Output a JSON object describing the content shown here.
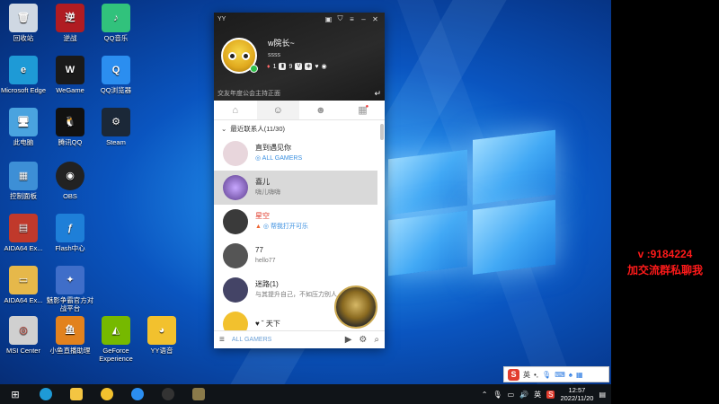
{
  "desktop_icons": [
    {
      "label": "回收站",
      "icon": "recycle-bin-icon",
      "color": "#cfd8e3"
    },
    {
      "label": "逆战",
      "icon": "nizhan-icon",
      "color": "#b01c22"
    },
    {
      "label": "QQ音乐",
      "icon": "qq-music-icon",
      "color": "#31c27c"
    },
    {
      "label": "Microsoft Edge",
      "icon": "edge-icon",
      "color": "#1e9ad6"
    },
    {
      "label": "WeGame",
      "icon": "wegame-icon",
      "color": "#1a1a1a"
    },
    {
      "label": "QQ浏览器",
      "icon": "qq-browser-icon",
      "color": "#2b8ef0"
    },
    {
      "label": "此电脑",
      "icon": "this-pc-icon",
      "color": "#4aa3df"
    },
    {
      "label": "腾讯QQ",
      "icon": "qq-icon",
      "color": "#111111"
    },
    {
      "label": "Steam",
      "icon": "steam-icon",
      "color": "#1b2838"
    },
    {
      "label": "控制面板",
      "icon": "control-panel-icon",
      "color": "#3d8fd6"
    },
    {
      "label": "OBS",
      "icon": "obs-icon",
      "color": "#222222"
    },
    {
      "label": "AIDA64 Ex...",
      "icon": "aida64-icon",
      "color": "#c0392b"
    },
    {
      "label": "Flash中心",
      "icon": "flash-center-icon",
      "color": "#1e7fd8"
    },
    {
      "label": "AIDA64 Ex...",
      "icon": "aida64-folder-icon",
      "color": "#e6b84a"
    },
    {
      "label": "魅影争霸官方对战平台",
      "icon": "game-platform-icon",
      "color": "#3f6ec9"
    },
    {
      "label": "MSI Center",
      "icon": "msi-center-icon",
      "color": "#d0d0d0"
    },
    {
      "label": "小鱼直播助理",
      "icon": "xiaoyu-icon",
      "color": "#e2821e"
    },
    {
      "label": "GeForce Experience",
      "icon": "geforce-icon",
      "color": "#76b900"
    },
    {
      "label": "YY语音",
      "icon": "yy-voice-icon",
      "color": "#f2c12e"
    }
  ],
  "yy_window": {
    "title": "YY",
    "username": "w院长~",
    "signature": "ssss",
    "badges": [
      "1",
      "9"
    ],
    "channel_text": "交友年度公会主持正面",
    "group": {
      "label": "最近联系人(11/30)"
    },
    "contacts": [
      {
        "name": "直到遇见你",
        "sub": "ALL GAMERS",
        "sub_style": "blue",
        "avatar": "#e8d6dc",
        "name_style": ""
      },
      {
        "name": "喜儿",
        "sub": "嗨儿嗨嗨",
        "sub_style": "",
        "avatar": "#6b4a8a",
        "name_style": ""
      },
      {
        "name": "星空",
        "sub": "帮我打开可乐",
        "sub_style": "blue",
        "avatar": "#3a3a3a",
        "name_style": "red"
      },
      {
        "name": "77",
        "sub": "hello77",
        "sub_style": "",
        "avatar": "#555555",
        "name_style": ""
      },
      {
        "name": "迷路(1)",
        "sub": "与其提升自己，不如压力别人",
        "sub_style": "",
        "avatar": "#444466",
        "name_style": ""
      },
      {
        "name": "♥ ˘ 天下",
        "sub": "",
        "sub_style": "",
        "avatar": "#f2c12e",
        "name_style": ""
      }
    ],
    "footer_label": "ALL GAMERS"
  },
  "overlay": {
    "line1": "v  :9184224",
    "line2": "加交流群私聊我"
  },
  "ime": {
    "mode": "英"
  },
  "taskbar": {
    "ime_lang": "英",
    "time": "12:57",
    "date": "2022/11/20"
  }
}
